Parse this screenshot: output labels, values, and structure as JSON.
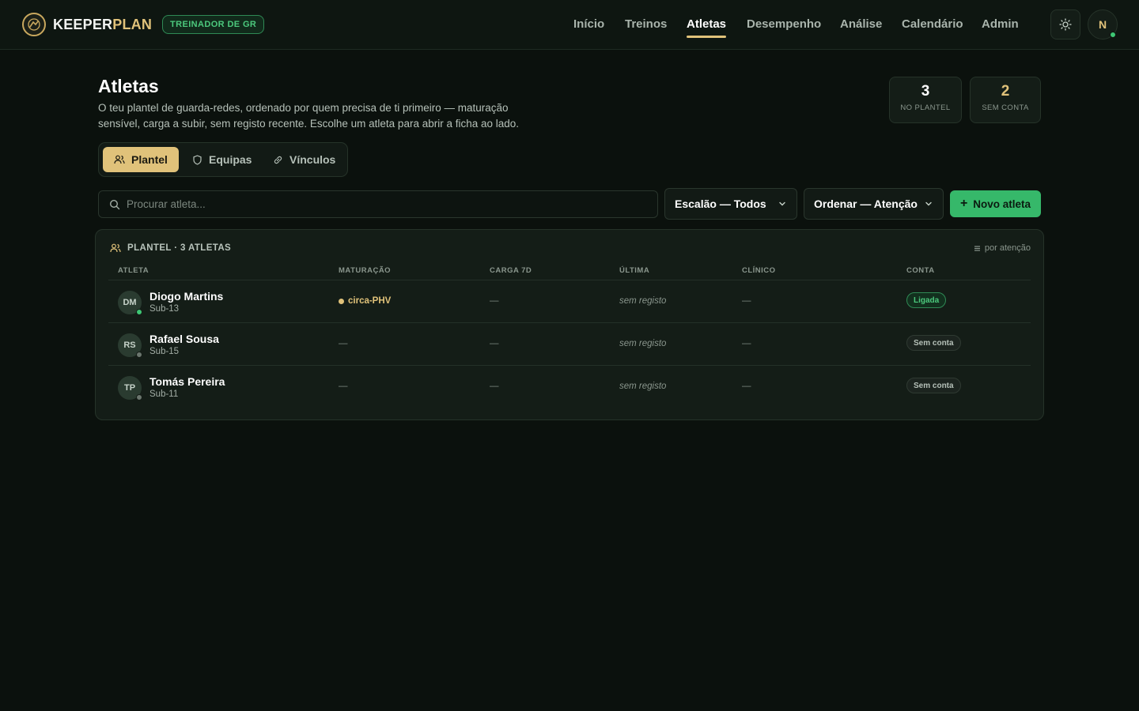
{
  "brand": {
    "name_part1": "KEEPER",
    "name_part2": "PLAN",
    "role": "TREINADOR DE GR"
  },
  "nav": [
    {
      "label": "Início"
    },
    {
      "label": "Treinos"
    },
    {
      "label": "Atletas",
      "active": true
    },
    {
      "label": "Desempenho"
    },
    {
      "label": "Análise"
    },
    {
      "label": "Calendário"
    },
    {
      "label": "Admin"
    }
  ],
  "user": {
    "initial": "N",
    "status": "online"
  },
  "page": {
    "title": "Atletas",
    "description": "O teu plantel de guarda-redes, ordenado por quem precisa de ti primeiro — maturação sensível, carga a subir, sem registo recente. Escolhe um atleta para abrir a ficha ao lado."
  },
  "stats": [
    {
      "value": "3",
      "label": "NO PLANTEL"
    },
    {
      "value": "2",
      "label": "SEM CONTA"
    }
  ],
  "tabs": [
    {
      "label": "Plantel",
      "icon": "users-icon",
      "active": true
    },
    {
      "label": "Equipas",
      "icon": "shield-icon"
    },
    {
      "label": "Vínculos",
      "icon": "link-icon"
    }
  ],
  "filters": {
    "search_placeholder": "Procurar atleta...",
    "escalao": "Escalão — Todos",
    "ordenar": "Ordenar — Atenção",
    "new_button": "Novo atleta"
  },
  "table": {
    "heading": "PLANTEL · 3 ATLETAS",
    "sort_note": "por atenção",
    "columns": [
      "ATLETA",
      "MATURAÇÃO",
      "CARGA 7D",
      "ÚLTIMA",
      "CLÍNICO",
      "CONTA"
    ],
    "rows": [
      {
        "initials": "DM",
        "name": "Diogo Martins",
        "squad": "Sub-13",
        "maturacao": "circa-PHV",
        "carga": "—",
        "ultima": "sem registo",
        "clinico": "—",
        "conta": "Ligada",
        "status_color": "#3ec774"
      },
      {
        "initials": "RS",
        "name": "Rafael Sousa",
        "squad": "Sub-15",
        "maturacao": "—",
        "carga": "—",
        "ultima": "sem registo",
        "clinico": "—",
        "conta": "Sem conta",
        "status_color": "#6b766e"
      },
      {
        "initials": "TP",
        "name": "Tomás Pereira",
        "squad": "Sub-11",
        "maturacao": "—",
        "carga": "—",
        "ultima": "sem registo",
        "clinico": "—",
        "conta": "Sem conta",
        "status_color": "#6b766e"
      }
    ]
  },
  "colors": {
    "accent_gold": "#e0c27a",
    "accent_green": "#36b86a",
    "background": "#0b110d"
  }
}
